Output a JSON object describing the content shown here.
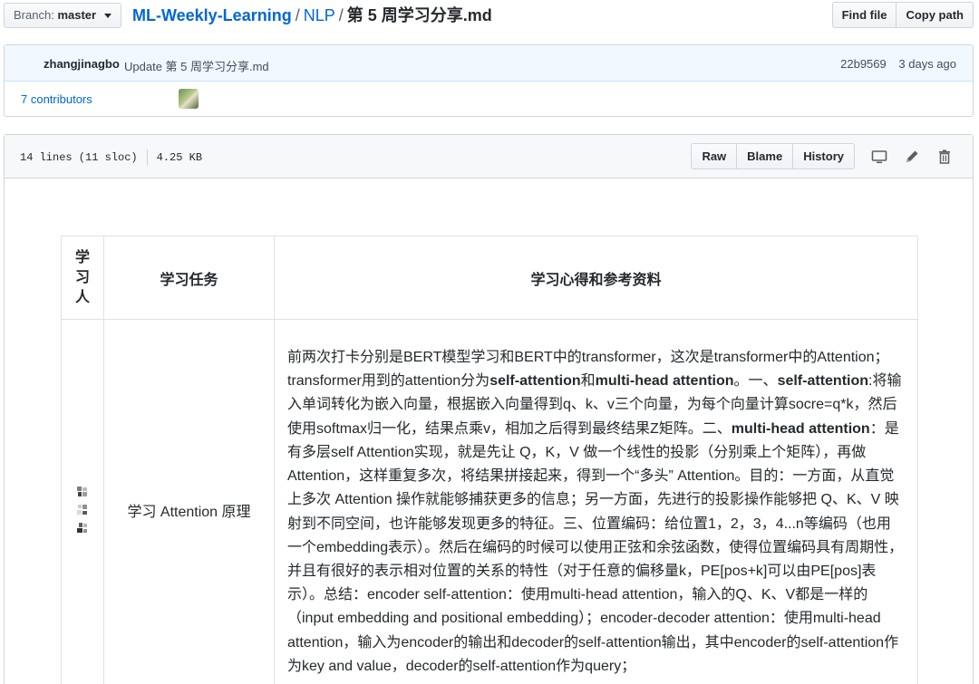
{
  "branch": {
    "prefix": "Branch:",
    "name": "master"
  },
  "breadcrumb": {
    "repo": "ML-Weekly-Learning",
    "sep": "/",
    "dir": "NLP",
    "file": "第 5 周学习分享.md"
  },
  "top_actions": {
    "find_file": "Find file",
    "copy_path": "Copy path"
  },
  "commit": {
    "author": "zhangjinagbo",
    "message": "Update 第 5 周学习分享.md",
    "sha": "22b9569",
    "time": "3 days ago",
    "contributors": "7 contributors"
  },
  "file": {
    "lines": "14 lines (11 sloc)",
    "size": "4.25 KB",
    "raw": "Raw",
    "blame": "Blame",
    "history": "History",
    "icons": [
      "desktop-icon",
      "pencil-icon",
      "trash-icon"
    ]
  },
  "table": {
    "headers": {
      "person": [
        "学",
        "习",
        "人"
      ],
      "task": "学习任务",
      "notes": "学习心得和参考资料"
    },
    "row": {
      "task": "学习 Attention 原理",
      "notes": [
        {
          "t": "前两次打卡分别是BERT模型学习和BERT中的transformer，这次是transformer中的Attention；transformer用到的attention分为"
        },
        {
          "t": "self-attention",
          "b": true
        },
        {
          "t": "和"
        },
        {
          "t": "multi-head attention",
          "b": true
        },
        {
          "t": "。一、"
        },
        {
          "t": "self-attention",
          "b": true
        },
        {
          "t": ":将输入单词转化为嵌入向量，根据嵌入向量得到q、k、v三个向量，为每个向量计算socre=q*k，然后使用softmax归一化，结果点乘v，相加之后得到最终结果Z矩阵。二、"
        },
        {
          "t": "multi-head attention",
          "b": true
        },
        {
          "t": "：是有多层self Attention实现，就是先让 Q，K，V 做一个线性的投影（分别乘上个矩阵），再做 Attention，这样重复多次，将结果拼接起来，得到一个“多头” Attention。目的：一方面，从直觉上多次 Attention 操作就能够捕获更多的信息；另一方面，先进行的投影操作能够把 Q、K、V 映射到不同空间，也许能够发现更多的特征。三、位置编码：给位置1，2，3，4...n等编码（也用一个embedding表示）。然后在编码的时候可以使用正弦和余弦函数，使得位置编码具有周期性，并且有很好的表示相对位置的关系的特性（对于任意的偏移量k，PE[pos+k]可以由PE[pos]表示）。总结：encoder self-attention：使用multi-head attention，输入的Q、K、V都是一样的（input embedding and positional embedding）；encoder-decoder attention：使用multi-head attention，输入为encoder的输出和decoder的self-attention输出，其中encoder的self-attention作为key and value，decoder的self-attention作为query；"
        }
      ]
    }
  }
}
